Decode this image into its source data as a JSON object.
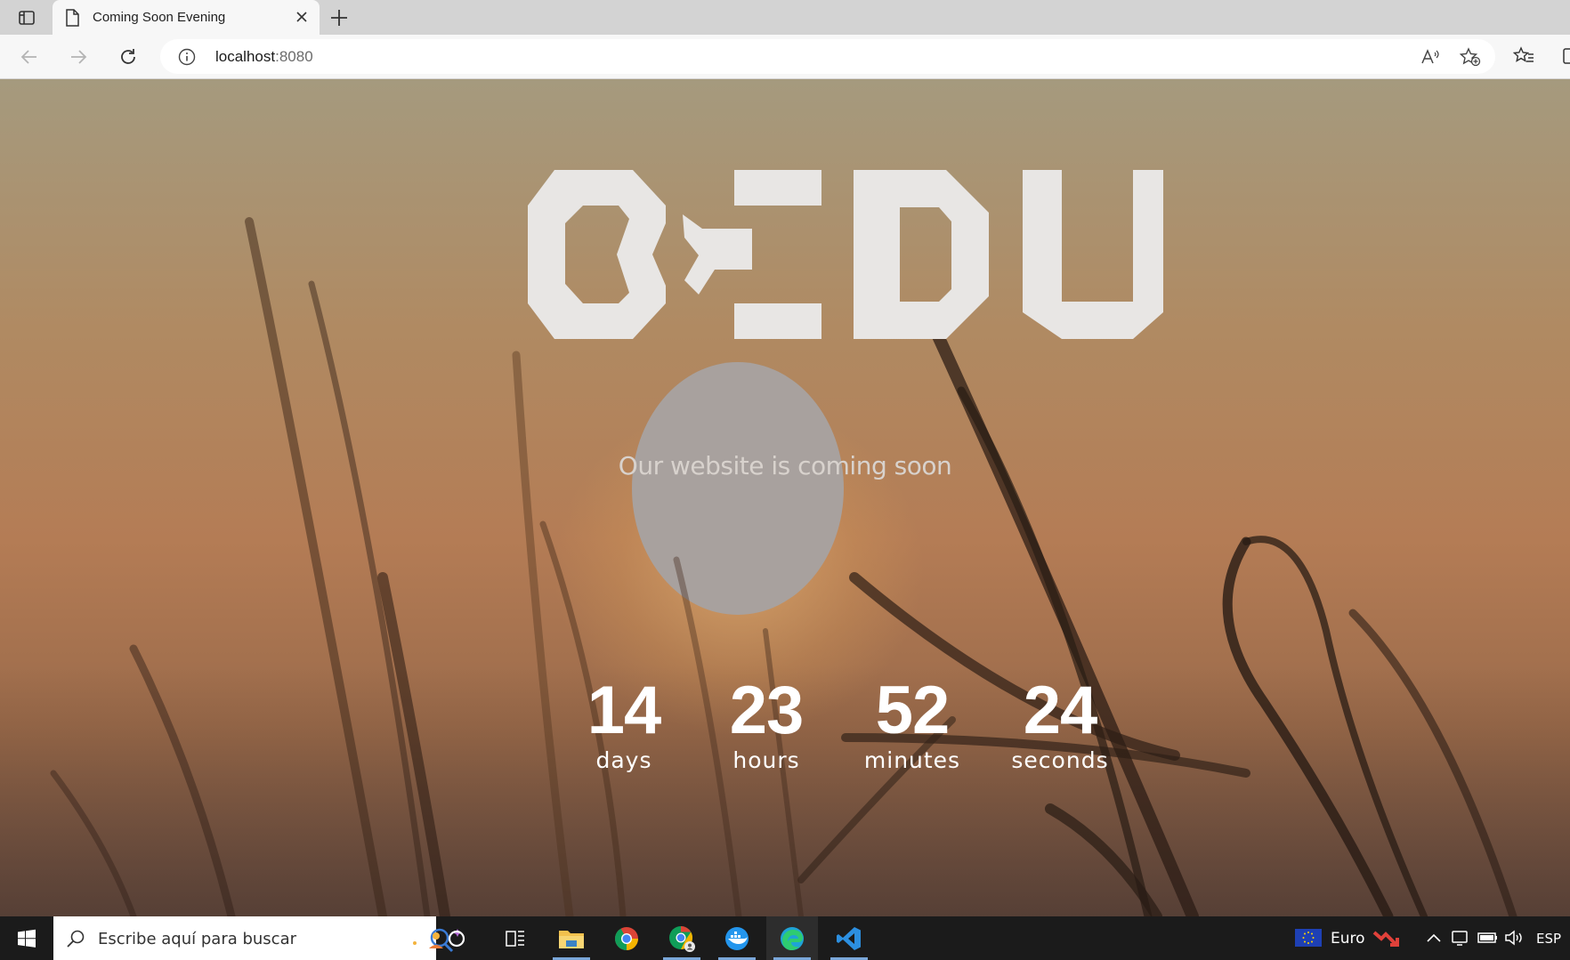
{
  "browser": {
    "tab_title": "Coming Soon Evening",
    "url_host": "localhost",
    "url_port": ":8080"
  },
  "page": {
    "logo_text": "BEDU",
    "tagline": "Our website is coming soon",
    "countdown": [
      {
        "value": "14",
        "unit": "days"
      },
      {
        "value": "23",
        "unit": "hours"
      },
      {
        "value": "52",
        "unit": "minutes"
      },
      {
        "value": "24",
        "unit": "seconds"
      }
    ]
  },
  "taskbar": {
    "search_placeholder": "Escribe aquí para buscar",
    "currency_label": "Euro",
    "language": "ESP",
    "pinned_apps": [
      "task-view-icon",
      "file-explorer-icon",
      "chrome-icon",
      "chrome-profile-icon",
      "docker-icon",
      "edge-icon",
      "vscode-icon"
    ]
  },
  "colors": {
    "accent": "#7aa7d9",
    "logo": "#e8e6e4",
    "sun": "#a8a19e"
  }
}
